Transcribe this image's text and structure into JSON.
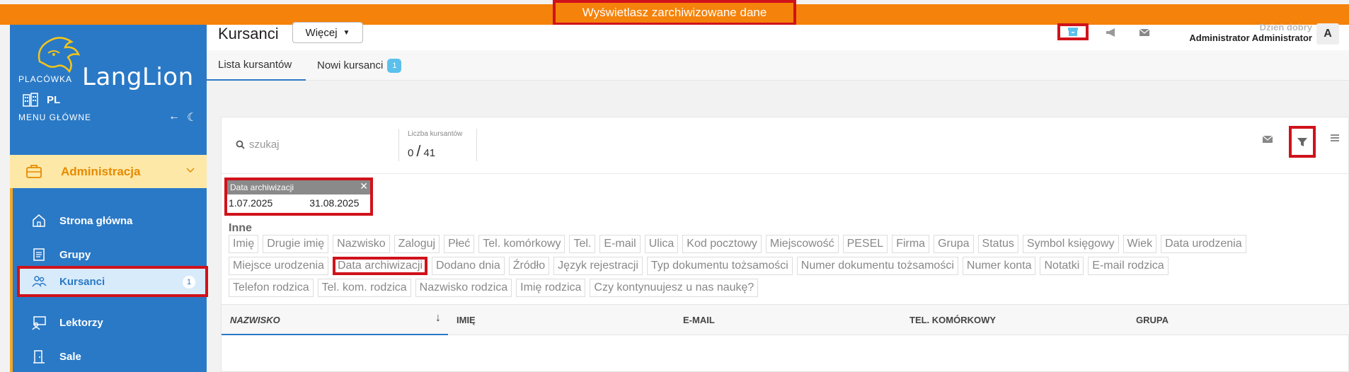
{
  "banner": {
    "text": "Wyświetlasz zarchiwizowane dane"
  },
  "sidebar": {
    "logo_text": "LangLion",
    "placowka_label": "PLACÓWKA",
    "placowka_value": "PL",
    "menu_label": "MENU GŁÓWNE",
    "section": "Administracja",
    "items": [
      {
        "label": "Strona główna",
        "icon": "home-icon"
      },
      {
        "label": "Grupy",
        "icon": "book-icon"
      },
      {
        "label": "Kursanci",
        "icon": "users-icon",
        "badge": "1",
        "active": true
      },
      {
        "label": "Lektorzy",
        "icon": "teacher-icon"
      },
      {
        "label": "Sale",
        "icon": "door-icon"
      }
    ]
  },
  "header": {
    "title": "Kursanci",
    "more_label": "Więcej",
    "greeting": "Dzień dobry",
    "user_name": "Administrator Administrator",
    "avatar_initial": "A"
  },
  "tabs": [
    {
      "label": "Lista kursantów",
      "active": true
    },
    {
      "label": "Nowi kursanci",
      "badge": "1"
    }
  ],
  "toolbar": {
    "search_placeholder": "szukaj",
    "count_label": "Liczba kursantów",
    "count_shown": "0",
    "count_total": "41"
  },
  "filter_chip": {
    "title": "Data archiwizacji",
    "from": "1.07.2025",
    "to": "31.08.2025"
  },
  "columns_picker": {
    "title": "Inne",
    "rows": [
      [
        "Imię",
        "Drugie imię",
        "Nazwisko",
        "Zaloguj",
        "Płeć",
        "Tel. komórkowy",
        "Tel.",
        "E-mail",
        "Ulica",
        "Kod pocztowy",
        "Miejscowość",
        "PESEL",
        "Firma",
        "Grupa",
        "Status",
        "Symbol księgowy",
        "Wiek",
        "Data urodzenia"
      ],
      [
        "Miejsce urodzenia",
        "Data archiwizacji",
        "Dodano dnia",
        "Źródło",
        "Język rejestracji",
        "Typ dokumentu tożsamości",
        "Numer dokumentu tożsamości",
        "Numer konta",
        "Notatki",
        "E-mail rodzica"
      ],
      [
        "Telefon rodzica",
        "Tel. kom. rodzica",
        "Nazwisko rodzica",
        "Imię rodzica",
        "Czy kontynuujesz u nas naukę?"
      ]
    ],
    "highlighted": "Data archiwizacji"
  },
  "table": {
    "columns": [
      "NAZWISKO",
      "IMIĘ",
      "E-MAIL",
      "TEL. KOMÓRKOWY",
      "GRUPA"
    ]
  },
  "colors": {
    "banner": "#f5820a",
    "sidebar": "#2a79c6",
    "highlight": "#d0121b",
    "admin_bg": "#fde8a8"
  }
}
